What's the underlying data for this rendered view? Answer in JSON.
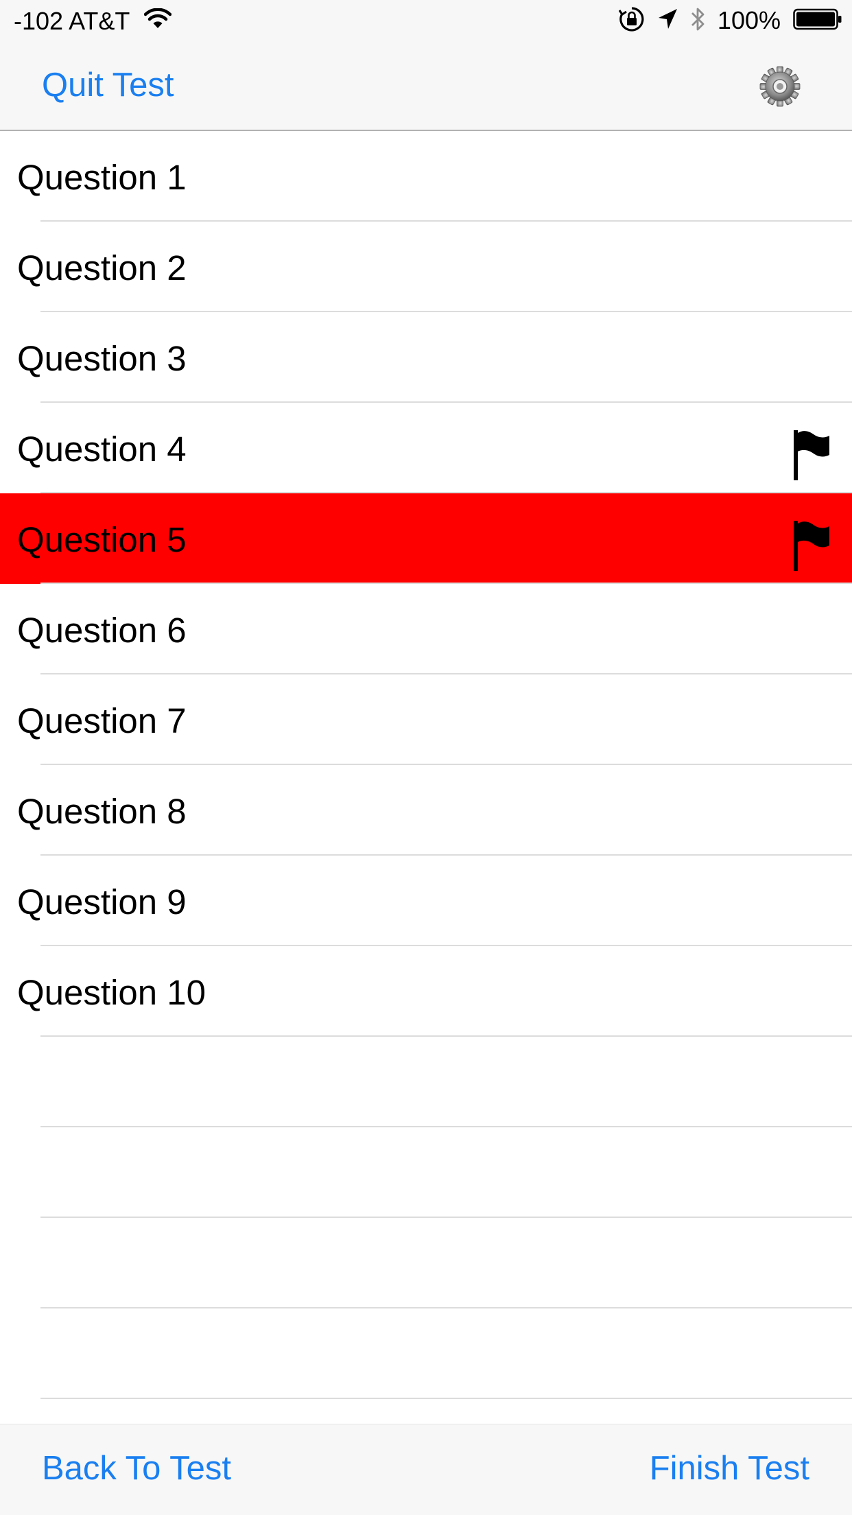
{
  "status_bar": {
    "carrier": "-102 AT&T",
    "battery_percent": "100%",
    "icons": [
      "wifi-icon",
      "rotation-lock-icon",
      "location-arrow-icon",
      "bluetooth-icon",
      "battery-icon"
    ]
  },
  "nav": {
    "quit_label": "Quit Test",
    "settings_icon": "gear-icon"
  },
  "questions": [
    {
      "label": "Question 1",
      "flagged": false,
      "highlighted": false
    },
    {
      "label": "Question 2",
      "flagged": false,
      "highlighted": false
    },
    {
      "label": "Question 3",
      "flagged": false,
      "highlighted": false
    },
    {
      "label": "Question 4",
      "flagged": true,
      "highlighted": false
    },
    {
      "label": "Question 5",
      "flagged": true,
      "highlighted": true
    },
    {
      "label": "Question 6",
      "flagged": false,
      "highlighted": false
    },
    {
      "label": "Question 7",
      "flagged": false,
      "highlighted": false
    },
    {
      "label": "Question 8",
      "flagged": false,
      "highlighted": false
    },
    {
      "label": "Question 9",
      "flagged": false,
      "highlighted": false
    },
    {
      "label": "Question 10",
      "flagged": false,
      "highlighted": false
    }
  ],
  "toolbar": {
    "back_label": "Back To Test",
    "finish_label": "Finish Test"
  },
  "colors": {
    "accent": "#1a7ff0",
    "highlight_row": "#ff0000",
    "separator": "#dcdcdc",
    "bar_background": "#f7f7f7"
  }
}
